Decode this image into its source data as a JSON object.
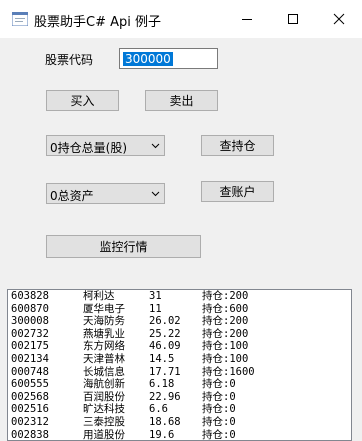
{
  "window": {
    "title": "股票助手C# Api 例子"
  },
  "form": {
    "code_label": "股票代码",
    "code_value": "300000",
    "buy_label": "买入",
    "sell_label": "卖出",
    "position_combo": "0持仓总量(股)",
    "query_position_label": "查持仓",
    "account_combo": "0总资产",
    "query_account_label": "查账户",
    "monitor_label": "监控行情"
  },
  "list": {
    "rows": [
      [
        "603828",
        "柯利达",
        "31",
        "持仓:200"
      ],
      [
        "600870",
        "厦华电子",
        "11",
        "持仓:600"
      ],
      [
        "300008",
        "天海防务",
        "26.02",
        "持仓:200"
      ],
      [
        "002732",
        "燕塘乳业",
        "25.22",
        "持仓:200"
      ],
      [
        "002175",
        "东方网络",
        "46.09",
        "持仓:100"
      ],
      [
        "002134",
        "天津普林",
        "14.5",
        "持仓:100"
      ],
      [
        "000748",
        "长城信息",
        "17.71",
        "持仓:1600"
      ],
      [
        "600555",
        "海航创新",
        "6.18",
        "持仓:0"
      ],
      [
        "002568",
        "百润股份",
        "22.96",
        "持仓:0"
      ],
      [
        "002516",
        "旷达科技",
        "6.6",
        "持仓:0"
      ],
      [
        "002312",
        "三泰控股",
        "18.68",
        "持仓:0"
      ],
      [
        "002838",
        "用道股份",
        "19.6",
        "持仓:0"
      ]
    ]
  }
}
